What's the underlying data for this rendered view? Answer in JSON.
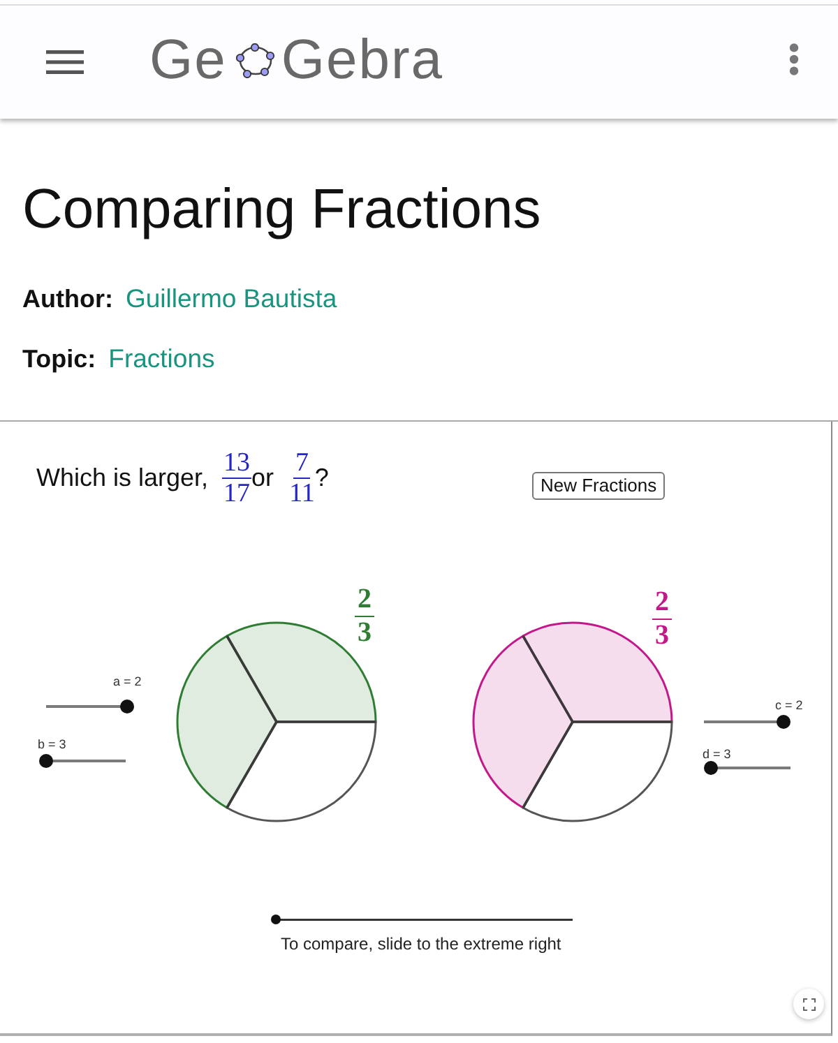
{
  "header": {
    "logo": {
      "text_start": "Ge",
      "text_end": "Gebra"
    }
  },
  "page": {
    "title": "Comparing Fractions",
    "meta": [
      {
        "label": "Author:",
        "value": "Guillermo Bautista"
      },
      {
        "label": "Topic:",
        "value": "Fractions"
      }
    ]
  },
  "applet": {
    "question": {
      "prefix": "Which is larger,",
      "fraction_1": {
        "numerator": "13",
        "denominator": "17"
      },
      "connector": "or",
      "fraction_2": {
        "numerator": "7",
        "denominator": "11"
      },
      "suffix": "?"
    },
    "new_button": "New Fractions",
    "pies": [
      {
        "numerator": "2",
        "denominator": "3",
        "color": "#2e7d32"
      },
      {
        "numerator": "2",
        "denominator": "3",
        "color": "#c2188a"
      }
    ],
    "sliders": [
      {
        "label": "a = 2",
        "level": 1
      },
      {
        "label": "b = 3",
        "level": 0
      },
      {
        "label": "c = 2",
        "level": 1
      },
      {
        "label": "d = 3",
        "level": 0
      }
    ],
    "compare_slider": {
      "caption": "To compare, slide to the extreme right",
      "level": 0
    }
  }
}
